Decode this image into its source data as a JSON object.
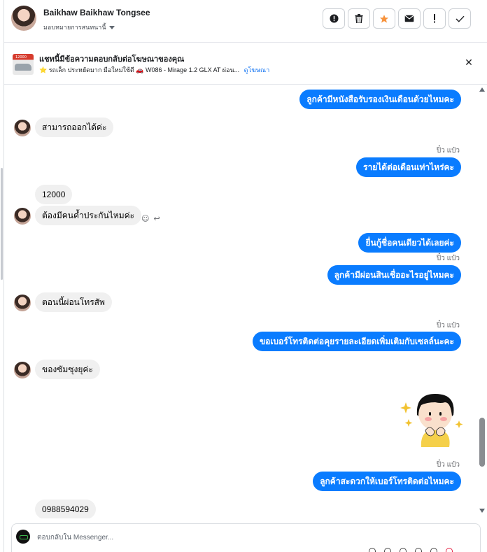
{
  "header": {
    "contact_name": "Baikhaw Baikhaw Tongsee",
    "assign_label": "มอบหมายการสนทนานี้",
    "actions": [
      {
        "name": "report-spam-button",
        "icon": "alert-circle-icon",
        "glyph": "!"
      },
      {
        "name": "delete-button",
        "icon": "trash-icon",
        "glyph": ""
      },
      {
        "name": "star-button",
        "icon": "star-icon",
        "glyph": "★"
      },
      {
        "name": "mark-unread-button",
        "icon": "envelope-icon",
        "glyph": "✉"
      },
      {
        "name": "mark-important-button",
        "icon": "exclamation-icon",
        "glyph": "!"
      },
      {
        "name": "mark-done-button",
        "icon": "check-icon",
        "glyph": ""
      }
    ]
  },
  "ad_banner": {
    "title": "แชทนี้มีข้อความตอบกลับต่อโฆษณาของคุณ",
    "subtitle": "⭐ รถเล็ก ประหยัดมาก มือใหม่ใช้ดี 🚗 W086 - Mirage 1.2 GLX AT ผ่อน...",
    "link": "ดูโฆษณา",
    "thumb_plate": "12000"
  },
  "messages": {
    "m1_out": "ลูกค้ามีหนังสือรับรองเงินเดือนด้วยไหมคะ",
    "m2_in": "สามารถออกได้ค่ะ",
    "m3_seen": "ปิ๋ว แป๋ว",
    "m3_out": "รายได้ต่อเดือนเท่าไหร่คะ",
    "m4_in": "12000",
    "m5_in": "ต้องมีคนค้ำประกันไหมค่ะ",
    "m6_out": "ยื่นกู้ชื่อคนเดียวได้เลยค่ะ",
    "m7_seen": "ปิ๋ว แป๋ว",
    "m7_out": "ลูกค้ามีผ่อนสินเชื่ออะไรอยู่ไหมคะ",
    "m8_in": "ตอนนี้ผ่อนโทรสัพ",
    "m9_seen": "ปิ๋ว แป๋ว",
    "m9_out": "ขอเบอร์โทรติดต่อคุยรายละเอียดเพิ่มเติมกับเซลล์นะคะ",
    "m10_in": "ของซัมซุงยุค่ะ",
    "m11_seen": "ปิ๋ว แป๋ว",
    "m11_out": "ลูกค้าสะดวกให้เบอร์โทรติดต่อไหมคะ",
    "m12_in": "0988594029"
  },
  "composer": {
    "placeholder": "ตอบกลับใน Messenger..."
  },
  "colors": {
    "outgoing_bubble": "#0a7cff",
    "incoming_bubble": "#f0f0f0",
    "link": "#1877f2",
    "star": "#f7923b"
  }
}
